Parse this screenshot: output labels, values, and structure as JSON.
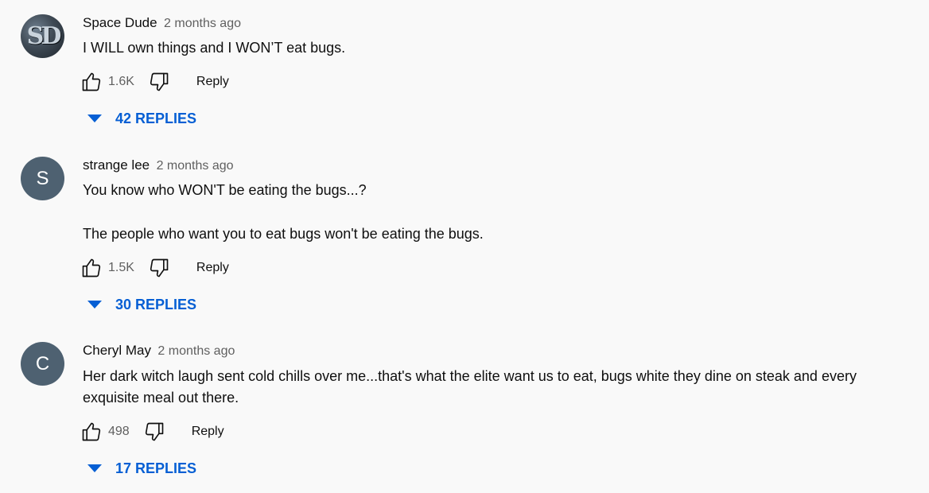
{
  "colors": {
    "background": "#f9f9f9",
    "link_blue": "#065fd4",
    "avatar_letter_bg": "#4e6171",
    "secondary_text": "#606060"
  },
  "comments": [
    {
      "avatar": {
        "type": "image",
        "monogram": "SD"
      },
      "author": "Space Dude",
      "time": "2 months ago",
      "text": [
        "I WILL own things and I WON’T eat bugs."
      ],
      "likes": "1.6K",
      "reply_label": "Reply",
      "replies_label": "42 REPLIES",
      "like_icon": "thumbs-up-icon",
      "dislike_icon": "thumbs-down-icon"
    },
    {
      "avatar": {
        "type": "letter",
        "letter": "S"
      },
      "author": "strange lee",
      "time": "2 months ago",
      "text": [
        "You know who WON'T be eating the bugs...?",
        "The people who want you to eat bugs won't be eating the bugs."
      ],
      "likes": "1.5K",
      "reply_label": "Reply",
      "replies_label": "30 REPLIES",
      "like_icon": "thumbs-up-icon",
      "dislike_icon": "thumbs-down-icon"
    },
    {
      "avatar": {
        "type": "letter",
        "letter": "C"
      },
      "author": "Cheryl May",
      "time": "2 months ago",
      "text": [
        "Her dark witch laugh sent cold chills over me...that's what the elite want us to eat, bugs white they dine on steak and every exquisite meal out there."
      ],
      "likes": "498",
      "reply_label": "Reply",
      "replies_label": "17 REPLIES",
      "like_icon": "thumbs-up-icon",
      "dislike_icon": "thumbs-down-icon"
    }
  ]
}
